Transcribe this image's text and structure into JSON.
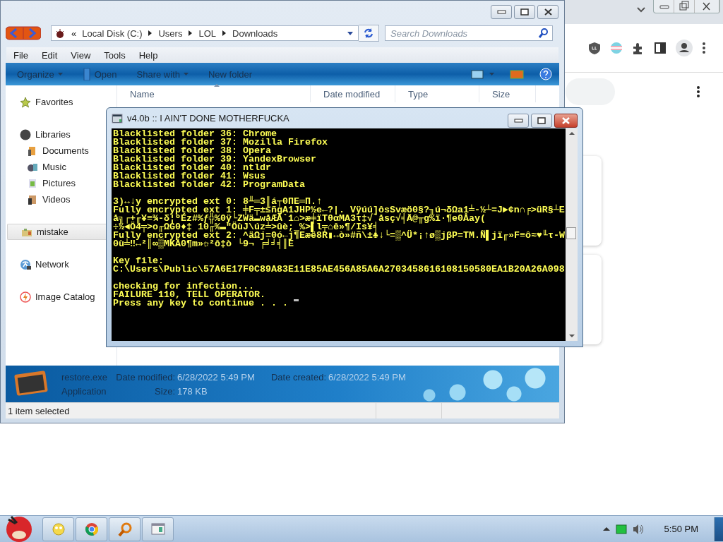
{
  "explorer": {
    "address": {
      "overflow_mark": "«",
      "crumbs": [
        "Local Disk (C:)",
        "Users",
        "LOL",
        "Downloads"
      ]
    },
    "search": {
      "placeholder": "Search Downloads"
    },
    "menu": [
      "File",
      "Edit",
      "View",
      "Tools",
      "Help"
    ],
    "toolbar": [
      {
        "label": "Organize",
        "has_menu": true
      },
      {
        "label": "Open",
        "has_menu": false
      },
      {
        "label": "Share with",
        "has_menu": true
      },
      {
        "label": "New folder",
        "has_menu": false
      }
    ],
    "columns": [
      "Name",
      "Date modified",
      "Type",
      "Size"
    ],
    "sidebar": [
      {
        "label": "Favorites",
        "selected": false
      },
      {
        "label": "Libraries",
        "selected": false,
        "children": [
          {
            "label": "Documents",
            "selected": false
          },
          {
            "label": "Music",
            "selected": false
          },
          {
            "label": "Pictures",
            "selected": false
          },
          {
            "label": "Videos",
            "selected": false
          }
        ]
      },
      {
        "label": "mistake",
        "selected": true
      },
      {
        "label": "Network",
        "selected": false
      },
      {
        "label": "Image Catalog",
        "selected": false
      }
    ],
    "details": {
      "file_name": "restore.exe",
      "file_type": "Application",
      "modified_label": "Date modified:",
      "modified_value": "6/28/2022 5:49 PM",
      "size_label": "Size:",
      "size_value": "178 KB",
      "created_label": "Date created:",
      "created_value": "6/28/2022 5:49 PM"
    },
    "status_bar": "1 item selected"
  },
  "console": {
    "title": "v4.0b :: I AIN'T DONE MOTHERFUCKA",
    "blocks": [
      [
        "Blacklisted folder 36: Chrome",
        "Blacklisted folder 37: Mozilla Firefox",
        "Blacklisted folder 38: Opera",
        "Blacklisted folder 39: YandexBrowser",
        "Blacklisted folder 40: ntldr",
        "Blacklisted folder 41: Wsus",
        "Blacklisted folder 42: ProgramData"
      ],
      [
        "3)↔↓y encrypted ext 0: 8╨═3║á┬0ΠE═Π.↑",
        "Fully encrypted ext 1: ╪F╤±≤ñgA1JHP½e←?|. Vÿúú]ôsSvæö0§?╖ú¬δΩa1╧-½┴=J►¢n∩╒>üR§┴E",
        "å╗┌+╓¥≡¾-δ¦ºÉz#%ƒ╬%0ÿ└ZWä▬wåÆÅ`1⌂>æ╪ïTθαMA3τ‡√`åsç√╡Ä@╥g%ï·¶e0Åay(",
        "÷½◄Ö4╤>o╓ΩG0♦‡ 10╓%▬\"ÖùJ\\úz╧>ûè;_%>▌l╤⌂ê»¶/Is¥╡",
        "Fully encrypted ext 2: ^äΩj=0ó←j¶Eæë8R▮↔ò»#ñ\\±♣↓└=▒^Ü*¡↑ø▒jβP=TM.Ñ▌jï╓»F≡ô≈♥╙τ-W",
        "0ù╧‼↔²║∞▒MKÅ0¶m»☼²ô‡ò └9¬ ╒╛╛╡║E"
      ],
      [
        "Key file:",
        "C:\\Users\\Public\\57A6E17F0C89A83E11E85AE456A85A6A2703458616108150580EA1B20A26A098"
      ],
      [
        "checking for infection...",
        "FAILURE 110, TELL OPERATOR.",
        "Press any key to continue . . ."
      ]
    ]
  },
  "taskbar": {
    "clock": "5:50 PM"
  }
}
